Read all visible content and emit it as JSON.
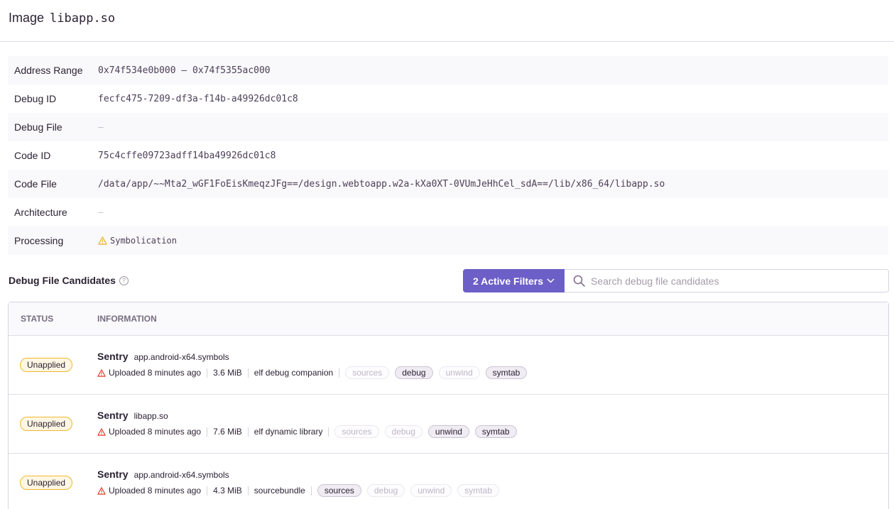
{
  "header": {
    "word": "Image",
    "name": "libapp.so"
  },
  "details": [
    {
      "key": "Address Range",
      "value": "0x74f534e0b000 – 0x74f5355ac000",
      "empty": false
    },
    {
      "key": "Debug ID",
      "value": "fecfc475-7209-df3a-f14b-a49926dc01c8",
      "empty": false
    },
    {
      "key": "Debug File",
      "value": "—",
      "empty": true
    },
    {
      "key": "Code ID",
      "value": "75c4cffe09723adff14ba49926dc01c8",
      "empty": false
    },
    {
      "key": "Code File",
      "value": "/data/app/~~Mta2_wGF1FoEisKmeqzJFg==/design.webtoapp.w2a-kXa0XT-0VUmJeHhCel_sdA==/lib/x86_64/libapp.so",
      "empty": false
    },
    {
      "key": "Architecture",
      "value": "—",
      "empty": true
    },
    {
      "key": "Processing",
      "value": "Symbolication",
      "empty": false,
      "icon": "warning-icon"
    }
  ],
  "candidates": {
    "title": "Debug File Candidates",
    "help_icon": "question-circle-icon",
    "filter_label": "2 Active Filters",
    "search_placeholder": "Search debug file candidates",
    "columns": {
      "status": "STATUS",
      "information": "INFORMATION"
    },
    "rows": [
      {
        "status": "Unapplied",
        "vendor": "Sentry",
        "file": "app.android-x64.symbols",
        "uploaded": "Uploaded 8 minutes ago",
        "size": "3.6 MiB",
        "kind": "elf debug companion",
        "tags": [
          {
            "label": "sources",
            "active": false
          },
          {
            "label": "debug",
            "active": true
          },
          {
            "label": "unwind",
            "active": false
          },
          {
            "label": "symtab",
            "active": true
          }
        ]
      },
      {
        "status": "Unapplied",
        "vendor": "Sentry",
        "file": "libapp.so",
        "uploaded": "Uploaded 8 minutes ago",
        "size": "7.6 MiB",
        "kind": "elf dynamic library",
        "tags": [
          {
            "label": "sources",
            "active": false
          },
          {
            "label": "debug",
            "active": false
          },
          {
            "label": "unwind",
            "active": true
          },
          {
            "label": "symtab",
            "active": true
          }
        ]
      },
      {
        "status": "Unapplied",
        "vendor": "Sentry",
        "file": "app.android-x64.symbols",
        "uploaded": "Uploaded 8 minutes ago",
        "size": "4.3 MiB",
        "kind": "sourcebundle",
        "tags": [
          {
            "label": "sources",
            "active": true
          },
          {
            "label": "debug",
            "active": false
          },
          {
            "label": "unwind",
            "active": false
          },
          {
            "label": "symtab",
            "active": false
          }
        ]
      }
    ]
  },
  "colors": {
    "accent": "#6c5fc7",
    "warning": "#f0b731",
    "error": "#e03e2f"
  }
}
